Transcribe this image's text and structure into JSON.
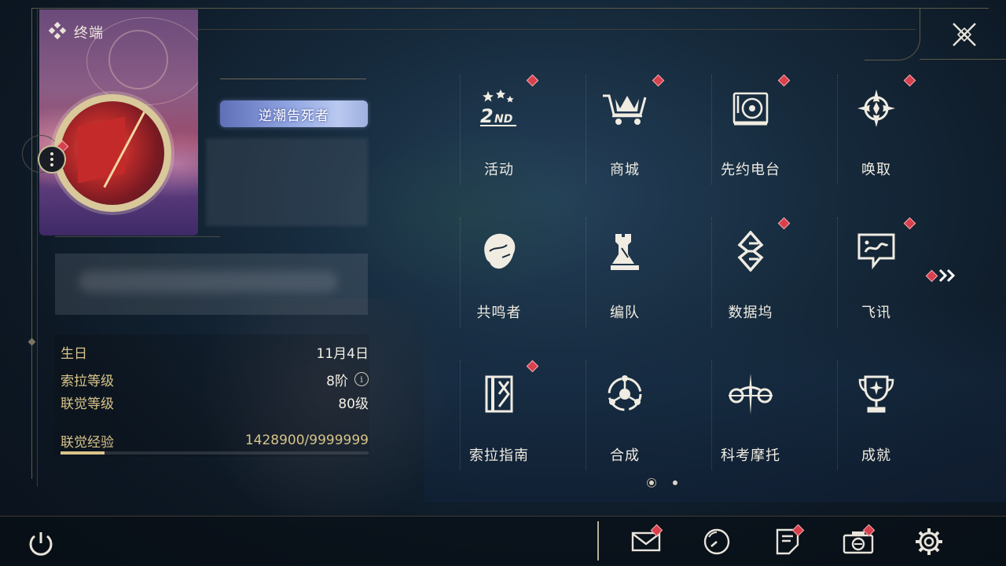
{
  "header": {
    "title": "终端"
  },
  "profile": {
    "title_badge": "逆潮告死者"
  },
  "stats": {
    "birthday_label": "生日",
    "birthday_value": "11月4日",
    "sola_level_label": "索拉等级",
    "sola_level_value": "8阶",
    "union_level_label": "联觉等级",
    "union_level_value": "80级",
    "union_exp_label": "联觉经验",
    "union_exp_value": "1428900/9999999",
    "union_exp_progress": 0.1429
  },
  "grid": {
    "items": [
      {
        "label": "活动",
        "icon": "events-2nd-anniversary-icon",
        "badge": true
      },
      {
        "label": "商城",
        "icon": "shop-cart-crown-icon",
        "badge": true
      },
      {
        "label": "先约电台",
        "icon": "radio-record-player-icon",
        "badge": true
      },
      {
        "label": "唤取",
        "icon": "convene-compass-icon",
        "badge": true
      },
      {
        "label": "共鸣者",
        "icon": "resonator-portrait-icon",
        "badge": false
      },
      {
        "label": "编队",
        "icon": "team-chess-icon",
        "badge": false
      },
      {
        "label": "数据坞",
        "icon": "data-bank-icon",
        "badge": true
      },
      {
        "label": "飞讯",
        "icon": "message-bubble-icon",
        "badge": true
      },
      {
        "label": "索拉指南",
        "icon": "guidebook-icon",
        "badge": true
      },
      {
        "label": "合成",
        "icon": "synthesis-orbit-icon",
        "badge": false
      },
      {
        "label": "科考摩托",
        "icon": "motorbike-icon",
        "badge": false
      },
      {
        "label": "成就",
        "icon": "achievement-trophy-icon",
        "badge": false
      }
    ]
  },
  "pager": {
    "current": 1,
    "total": 2
  },
  "bottom_bar": {
    "buttons": [
      {
        "icon": "mail-icon",
        "badge": true
      },
      {
        "icon": "time-clock-icon",
        "badge": false
      },
      {
        "icon": "notice-board-icon",
        "badge": true
      },
      {
        "icon": "camera-icon",
        "badge": true
      },
      {
        "icon": "settings-gear-icon",
        "badge": false
      }
    ]
  },
  "colors": {
    "accent_gold": "#d8c48a",
    "badge_red": "#d8404e",
    "background": "#0d1824"
  }
}
